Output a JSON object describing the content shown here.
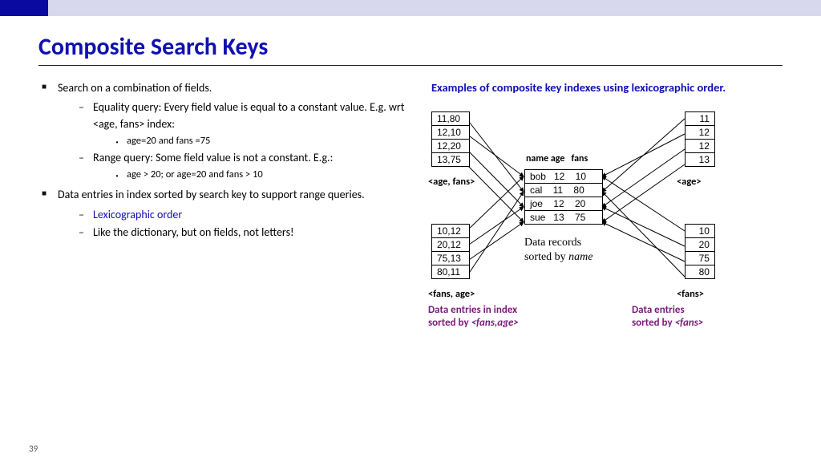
{
  "title": "Composite Search Keys",
  "page_number": "39",
  "bullets": {
    "b1": "Search on a combination of fields.",
    "b1a": "Equality query: Every field value is equal to a constant value. E.g. wrt <age, fans> index:",
    "b1a1": "age=20 and fans =75",
    "b1b": "Range query: Some field value is not a constant. E.g.:",
    "b1b1": "age > 20; or age=20 and fans > 10",
    "b2": "Data entries in index sorted by search key to support range queries.",
    "b2a": "Lexicographic order",
    "b2b": "Like the dictionary, but on fields, not letters!"
  },
  "caption": "Examples of composite key indexes using lexicographic order.",
  "center_header": "name age   fans",
  "center_rows": [
    "bob   12    10",
    "cal    11    80",
    "joe    12    20",
    "sue   13    75"
  ],
  "center_sub1": "Data records",
  "center_sub2_html": "sorted by <i>name</i>",
  "age_fans": [
    "11,80",
    "12,10",
    "12,20",
    "13,75"
  ],
  "age_fans_lbl": "<age, fans>",
  "fans_age": [
    "10,12",
    "20,12",
    "75,13",
    "80,11"
  ],
  "fans_age_lbl": "<fans, age>",
  "age": [
    "11",
    "12",
    "12",
    "13"
  ],
  "age_lbl": "<age>",
  "fans": [
    "10",
    "20",
    "75",
    "80"
  ],
  "fans_lbl": "<fans>",
  "sub_left_html": "Data entries in index<br>sorted by <i>&lt;fans,age&gt;</i>",
  "sub_right_html": "Data entries<br>sorted by <i>&lt;fans&gt;</i>"
}
